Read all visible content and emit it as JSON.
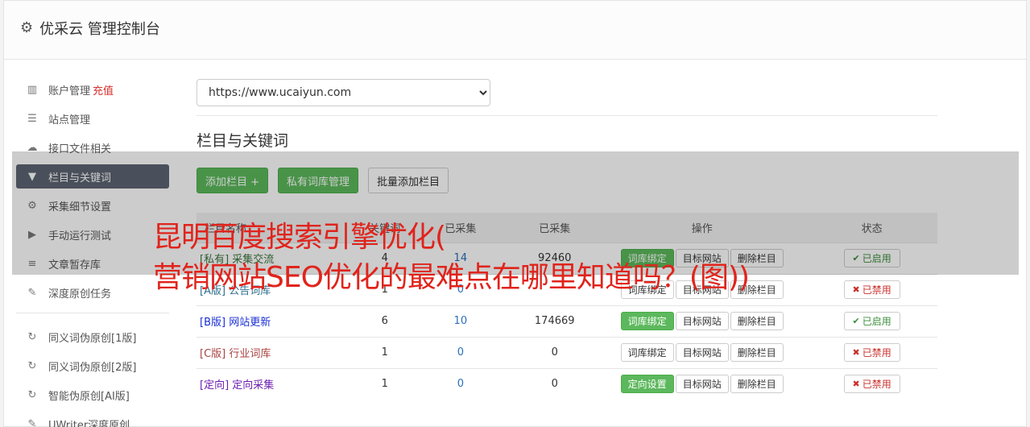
{
  "header": {
    "title": "优采云 管理控制台",
    "icon": "gear-icon"
  },
  "sidebar": {
    "items": [
      {
        "label": "账户管理",
        "extra": "充值",
        "icon": "bar-chart-icon"
      },
      {
        "label": "站点管理",
        "icon": "server-icon"
      },
      {
        "label": "接口文件相关",
        "icon": "cloud-upload-icon"
      },
      {
        "label": "栏目与关键词",
        "icon": "filter-icon",
        "active": true
      },
      {
        "label": "采集细节设置",
        "icon": "cogs-icon"
      },
      {
        "label": "手动运行测试",
        "icon": "play-circle-icon"
      },
      {
        "label": "文章暂存库",
        "icon": "database-icon"
      },
      {
        "label": "深度原创任务",
        "icon": "edit-icon"
      }
    ],
    "items2": [
      {
        "label": "同义词伪原创[1版]",
        "icon": "refresh-icon"
      },
      {
        "label": "同义词伪原创[2版]",
        "icon": "refresh-icon"
      },
      {
        "label": "智能伪原创[AI版]",
        "icon": "refresh-icon"
      },
      {
        "label": "UWriter深度原创",
        "icon": "edit-icon"
      }
    ]
  },
  "main": {
    "site_select": "https://www.ucaiyun.com",
    "section_title": "栏目与关键词",
    "buttons": {
      "add_column": "添加栏目 +",
      "private_lib": "私有词库管理",
      "batch_add": "批量添加栏目"
    },
    "table": {
      "headers": [
        "栏目名称",
        "关键词",
        "已采集",
        "已采集",
        "操作",
        "状态"
      ],
      "rows": [
        {
          "tag": "[私有]",
          "name": "采集交流",
          "c1": "4",
          "c2": "14",
          "c3": "92460",
          "op1": "词库绑定",
          "op1_green": true,
          "op2": "目标网站",
          "op3": "删除栏目",
          "status": "已启用",
          "on": true
        },
        {
          "tag": "[A版]",
          "name": "公告词库",
          "c1": "1",
          "c2": "0",
          "c3": "",
          "op1": "词库绑定",
          "op1_green": false,
          "op2": "目标网站",
          "op3": "删除栏目",
          "status": "已禁用",
          "on": false
        },
        {
          "tag": "[B版]",
          "name": "网站更新",
          "c1": "6",
          "c2": "10",
          "c3": "174669",
          "op1": "词库绑定",
          "op1_green": true,
          "op2": "目标网站",
          "op3": "删除栏目",
          "status": "已启用",
          "on": true
        },
        {
          "tag": "[C版]",
          "name": "行业词库",
          "c1": "1",
          "c2": "0",
          "c3": "0",
          "op1": "词库绑定",
          "op1_green": false,
          "op2": "目标网站",
          "op3": "删除栏目",
          "status": "已禁用",
          "on": false
        },
        {
          "tag": "[定向]",
          "name": "定向采集",
          "c1": "1",
          "c2": "0",
          "c3": "0",
          "op1": "定向设置",
          "op1_green": true,
          "op2": "目标网站",
          "op3": "删除栏目",
          "status": "已禁用",
          "on": false
        }
      ]
    }
  },
  "overlay": {
    "line1": "昆明百度搜索引擎优化(",
    "line2": "营销网站SEO优化的最难点在哪里知道吗？(图))"
  },
  "colors": {
    "accent": "#5cb85c",
    "active_sidebar": "#5d6572",
    "headline": "#e0241c",
    "danger": "#c9302c"
  }
}
